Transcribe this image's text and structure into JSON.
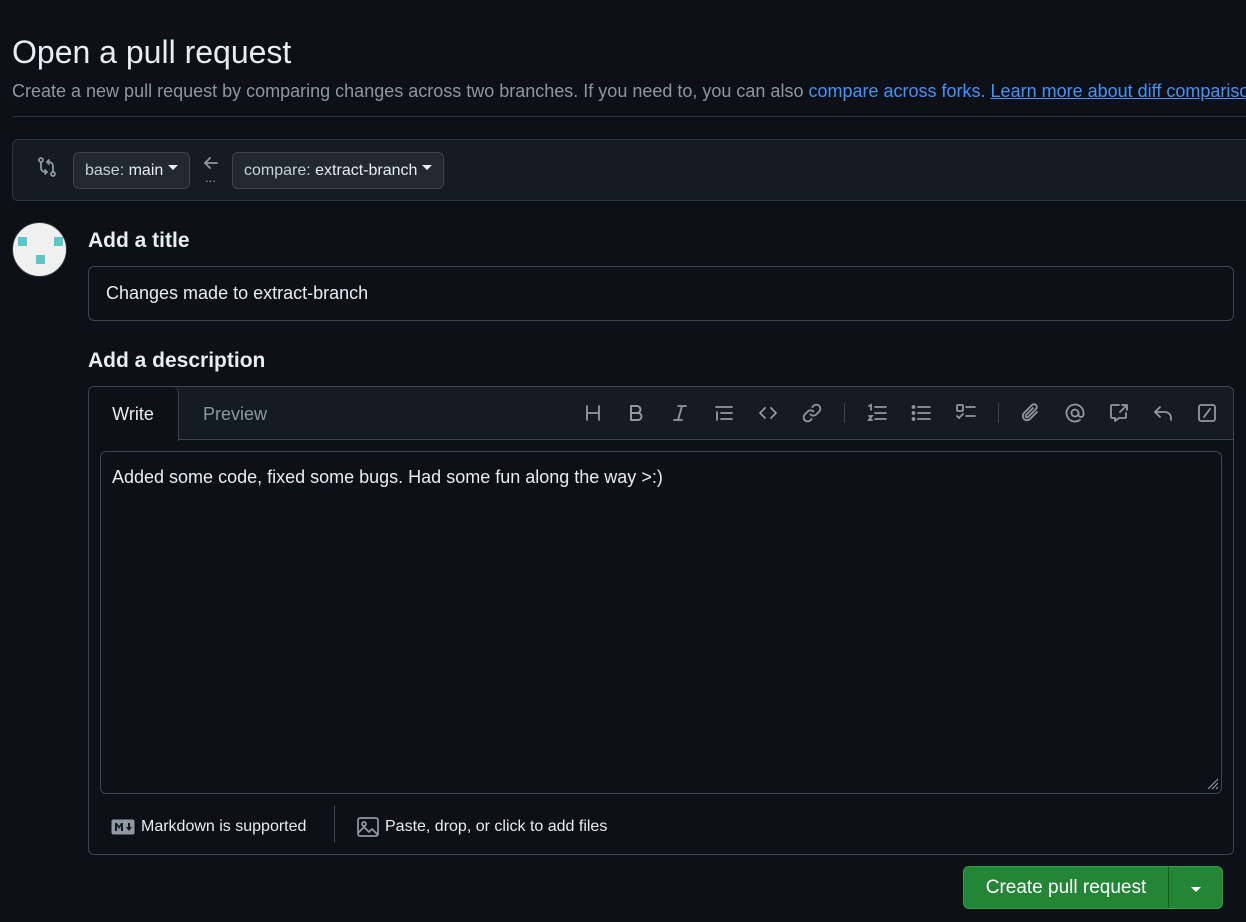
{
  "header": {
    "title": "Open a pull request",
    "subtitle_text": "Create a new pull request by comparing changes across two branches. If you need to, you can also ",
    "compare_forks_link": "compare across forks.",
    "learn_more_link": "Learn more about diff comparisons"
  },
  "range": {
    "base_prefix": "base: ",
    "base_branch": "main",
    "compare_prefix": "compare: ",
    "compare_branch": "extract-branch",
    "ellipsis": "..."
  },
  "form": {
    "title_label": "Add a title",
    "title_value": "Changes made to extract-branch",
    "description_label": "Add a description",
    "tabs": [
      "Write",
      "Preview"
    ],
    "active_tab": "Write",
    "description_value": "Added some code, fixed some bugs. Had some fun along the way >:)",
    "toolbar_icons": [
      "heading-icon",
      "bold-icon",
      "italic-icon",
      "quote-icon",
      "code-icon",
      "link-icon",
      "ordered-list-icon",
      "unordered-list-icon",
      "task-list-icon",
      "attach-icon",
      "mention-icon",
      "cross-reference-icon",
      "reply-icon",
      "slash-command-icon"
    ],
    "markdown_note": "Markdown is supported",
    "attach_note": "Paste, drop, or click to add files"
  },
  "actions": {
    "create_label": "Create pull request"
  },
  "colors": {
    "background": "#0d1117",
    "accent_green": "#238636",
    "link_blue": "#4493f8",
    "border": "#3d444d"
  }
}
